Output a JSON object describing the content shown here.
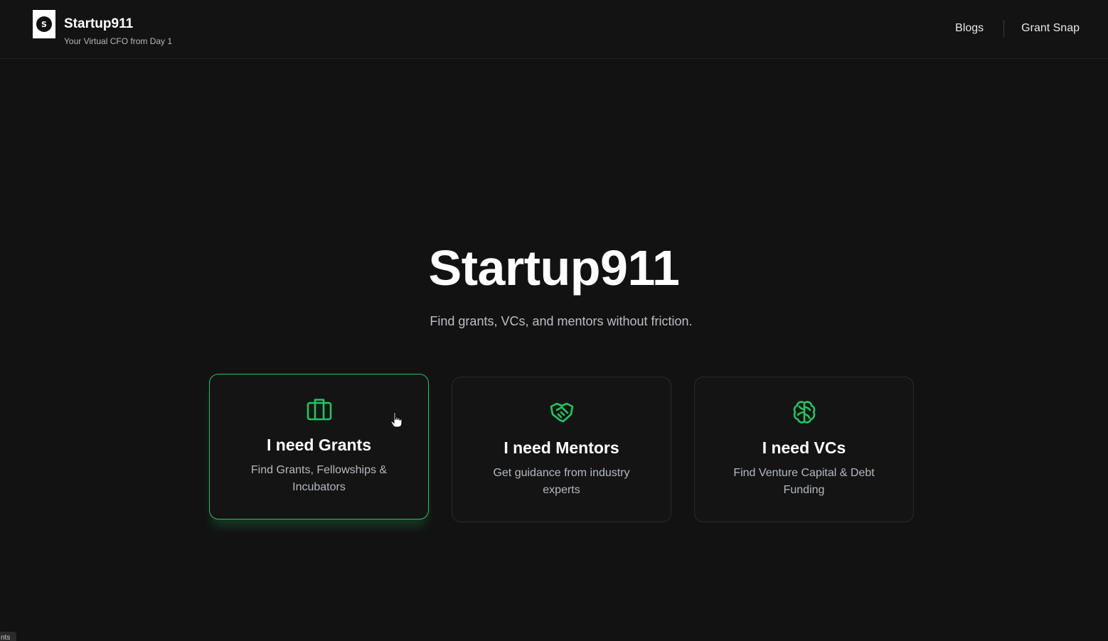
{
  "header": {
    "logo_letter": "S",
    "brand_name": "Startup911",
    "tagline": "Your Virtual CFO from Day 1",
    "nav": [
      {
        "label": "Blogs"
      },
      {
        "label": "Grant Snap"
      }
    ]
  },
  "hero": {
    "title": "Startup911",
    "subtitle": "Find grants, VCs, and mentors without friction."
  },
  "cards": [
    {
      "title": "I need Grants",
      "description": "Find Grants, Fellowships & Incubators",
      "icon": "briefcase-icon",
      "active": true
    },
    {
      "title": "I need Mentors",
      "description": "Get guidance from industry experts",
      "icon": "handshake-icon",
      "active": false
    },
    {
      "title": "I need VCs",
      "description": "Find Venture Capital & Debt Funding",
      "icon": "brain-icon",
      "active": false
    }
  ],
  "status_tab": "nts",
  "colors": {
    "accent": "#22c55e",
    "background": "#121212",
    "card_border": "#2b2b2b"
  }
}
